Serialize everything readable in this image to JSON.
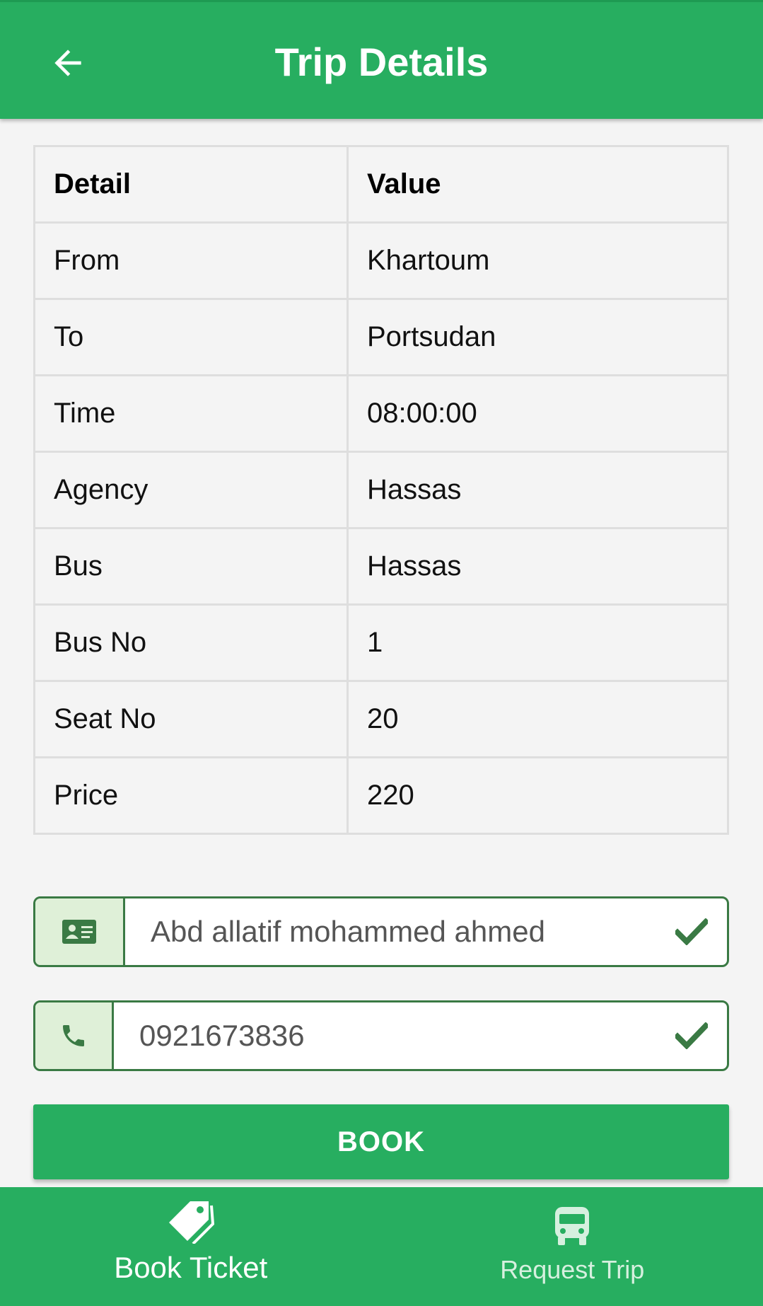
{
  "header": {
    "title": "Trip Details",
    "back_icon": "arrow-back-icon"
  },
  "table": {
    "headers": [
      "Detail",
      "Value"
    ],
    "rows": [
      {
        "detail": "From",
        "value": "Khartoum"
      },
      {
        "detail": "To",
        "value": "Portsudan"
      },
      {
        "detail": "Time",
        "value": "08:00:00"
      },
      {
        "detail": "Agency",
        "value": "Hassas"
      },
      {
        "detail": "Bus",
        "value": "Hassas"
      },
      {
        "detail": "Bus No",
        "value": "1"
      },
      {
        "detail": "Seat No",
        "value": "20"
      },
      {
        "detail": "Price",
        "value": "220"
      }
    ]
  },
  "form": {
    "name_value": "Abd allatif mohammed ahmed",
    "name_icon": "id-card-icon",
    "phone_value": "0921673836",
    "phone_icon": "phone-icon",
    "valid_icon": "check-icon"
  },
  "actions": {
    "book_label": "BOOK"
  },
  "bottom_nav": {
    "items": [
      {
        "label": "Book Ticket",
        "icon": "tags-icon",
        "active": true
      },
      {
        "label": "Request Trip",
        "icon": "bus-icon",
        "active": false
      }
    ]
  },
  "colors": {
    "primary": "#27ae60",
    "field_border": "#3a7a44",
    "field_icon_bg": "#dff0d8",
    "check": "#3a7a44"
  }
}
